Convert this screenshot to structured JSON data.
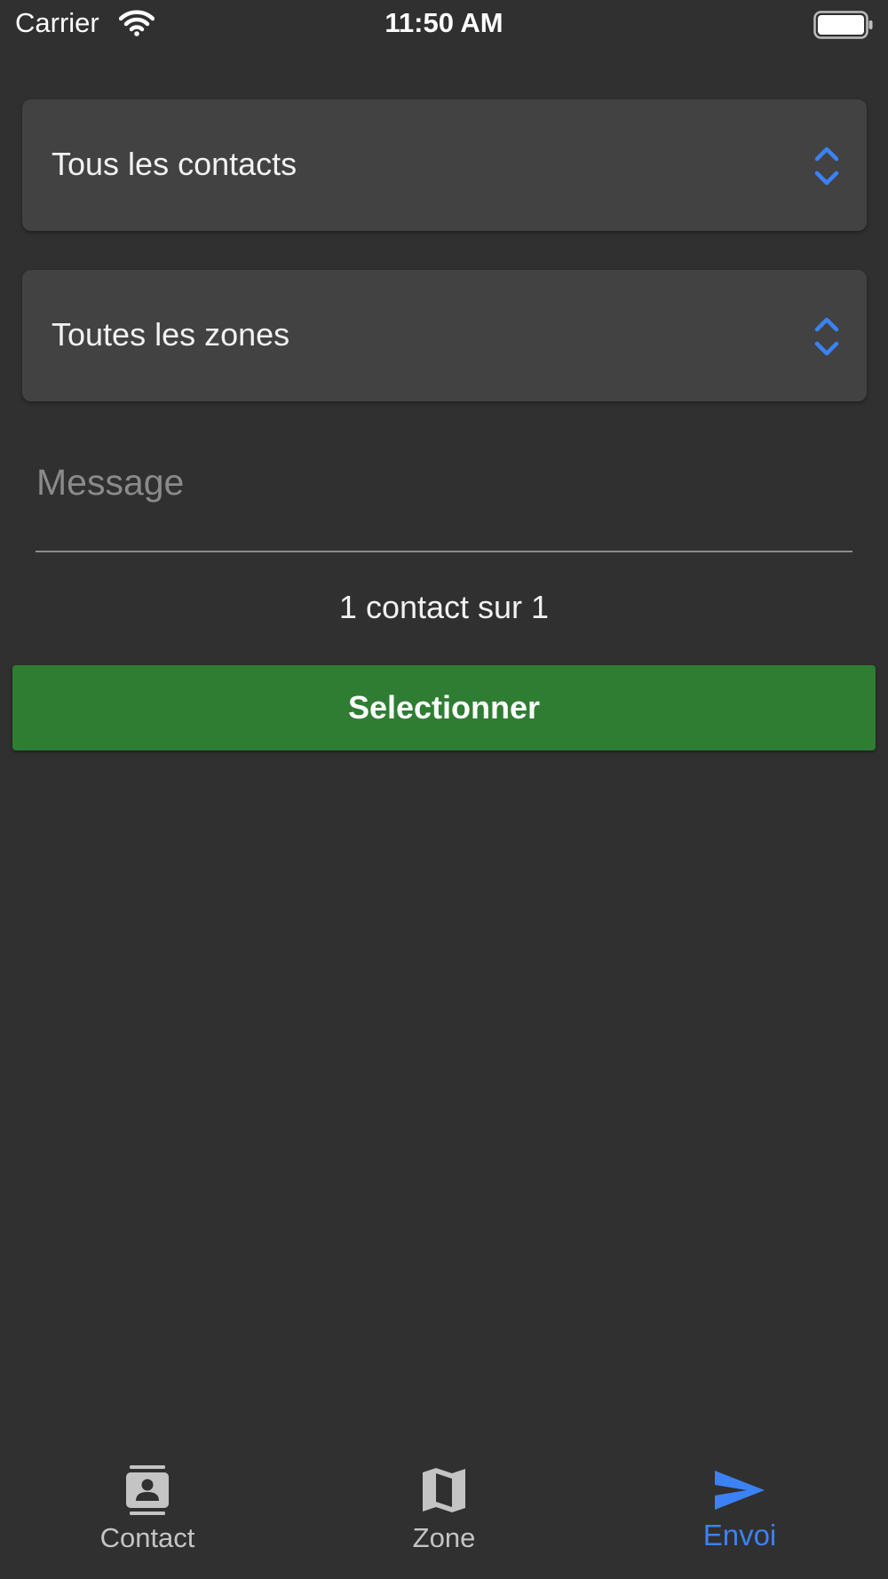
{
  "status_bar": {
    "carrier": "Carrier",
    "time": "11:50 AM",
    "icons": [
      "wifi-icon",
      "battery-icon"
    ]
  },
  "pickers": [
    {
      "label": "Tous les contacts",
      "icon": "chevron-up-down-icon"
    },
    {
      "label": "Toutes les zones",
      "icon": "chevron-up-down-icon"
    }
  ],
  "message": {
    "placeholder": "Message",
    "value": ""
  },
  "count_text": "1 contact sur 1",
  "select_button": {
    "label": "Selectionner"
  },
  "tabs": [
    {
      "label": "Contact",
      "icon": "contact-book-icon",
      "active": false
    },
    {
      "label": "Zone",
      "icon": "map-icon",
      "active": false
    },
    {
      "label": "Envoi",
      "icon": "send-icon",
      "active": true
    }
  ],
  "colors": {
    "background": "#303030",
    "picker_background": "#424242",
    "accent": "#3b82f6",
    "button_green": "#2e7d32",
    "inactive_tab": "#c4c4c4"
  }
}
